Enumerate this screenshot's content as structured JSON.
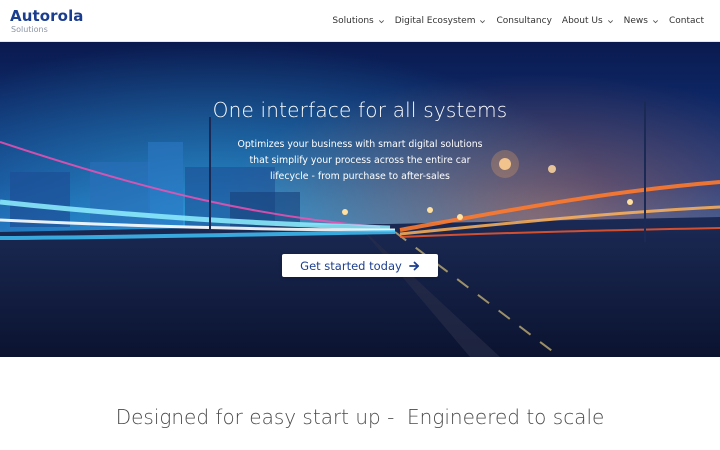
{
  "header": {
    "logo": {
      "brand": "Autorola",
      "sub": "Solutions"
    },
    "nav": [
      {
        "label": "Solutions",
        "dropdown": true
      },
      {
        "label": "Digital Ecosystem",
        "dropdown": true
      },
      {
        "label": "Consultancy",
        "dropdown": false
      },
      {
        "label": "About Us",
        "dropdown": true
      },
      {
        "label": "News",
        "dropdown": true
      },
      {
        "label": "Contact",
        "dropdown": false
      }
    ]
  },
  "hero": {
    "title": "One interface for all systems",
    "subtitle": "Optimizes your business with smart digital solutions that simplify your process across the entire car lifecycle - from purchase to after-sales",
    "cta_label": "Get started today",
    "cta_icon": "arrow-right-icon"
  },
  "section": {
    "title": "Designed for easy start up -  Engineered to scale"
  },
  "colors": {
    "brand": "#1a3d8f",
    "nav_text": "#333333",
    "hero_overlay": "#0a1f55",
    "cta_text": "#1e3f8f",
    "section_title": "#4a4a4a"
  }
}
